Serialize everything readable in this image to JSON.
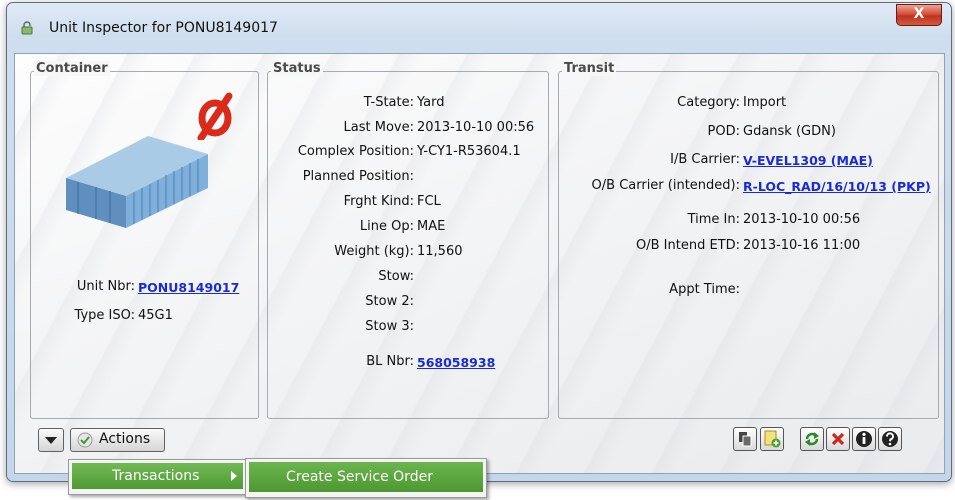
{
  "window": {
    "title": "Unit Inspector for PONU8149017",
    "close_label": "X"
  },
  "container": {
    "legend": "Container",
    "unit_nbr_label": "Unit Nbr:",
    "unit_nbr_value": "PONU8149017",
    "type_iso_label": "Type ISO:",
    "type_iso_value": "45G1",
    "no_entry_icon": "null-symbol-icon",
    "image_icon": "shipping-container-icon"
  },
  "status": {
    "legend": "Status",
    "fields": [
      {
        "label": "T-State:",
        "value": "Yard"
      },
      {
        "label": "Last Move:",
        "value": "2013-10-10 00:56"
      },
      {
        "label": "Complex Position:",
        "value": "Y-CY1-R53604.1"
      },
      {
        "label": "Planned Position:",
        "value": ""
      },
      {
        "label": "Frght Kind:",
        "value": "FCL"
      },
      {
        "label": "Line Op:",
        "value": "MAE"
      },
      {
        "label": "Weight (kg):",
        "value": "11,560"
      },
      {
        "label": "Stow:",
        "value": ""
      },
      {
        "label": "Stow 2:",
        "value": ""
      },
      {
        "label": "Stow 3:",
        "value": ""
      }
    ],
    "bl_label": "BL Nbr:",
    "bl_value": "568058938"
  },
  "transit": {
    "legend": "Transit",
    "category_label": "Category:",
    "category_value": "Import",
    "pod_label": "POD:",
    "pod_value": "Gdansk (GDN)",
    "ib_label": "I/B Carrier:",
    "ib_value": "V-EVEL1309 (MAE)",
    "ob_label": "O/B Carrier (intended):",
    "ob_value": "R-LOC_RAD/16/10/13 (PKP)",
    "time_in_label": "Time In:",
    "time_in_value": "2013-10-10 00:56",
    "ob_etd_label": "O/B Intend ETD:",
    "ob_etd_value": "2013-10-16 11:00",
    "appt_label": "Appt Time:"
  },
  "toolbar": {
    "actions_label": "Actions",
    "tools": [
      "copy-icon",
      "add-note-icon",
      "refresh-icon",
      "close-red-icon",
      "info-icon",
      "help-icon"
    ]
  },
  "menu": {
    "transactions_label": "Transactions",
    "create_service_order_label": "Create Service Order",
    "highlight_color": "#5aa83c"
  }
}
